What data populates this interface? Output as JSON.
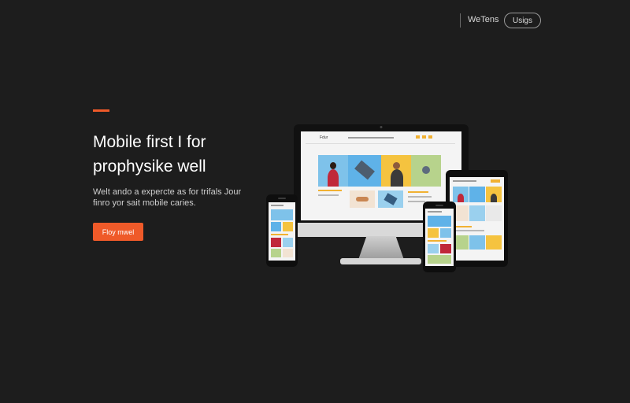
{
  "nav": {
    "link_label": "WeTens",
    "pill_label": "Usigs"
  },
  "hero": {
    "title": "Mobile first I for prophysike well",
    "subtitle": "Welt ando a expercte as for trifals Jour finro yor sait mobile caries.",
    "cta_label": "Floy mwel"
  },
  "colors": {
    "background": "#1d1d1d",
    "accent": "#ef5a29",
    "text_primary": "#ffffff",
    "text_secondary": "#cfcfcf"
  },
  "devices": {
    "desktop_brand": "Fdur",
    "items": [
      "desktop-monitor",
      "tablet",
      "phone-left",
      "phone-right"
    ]
  }
}
